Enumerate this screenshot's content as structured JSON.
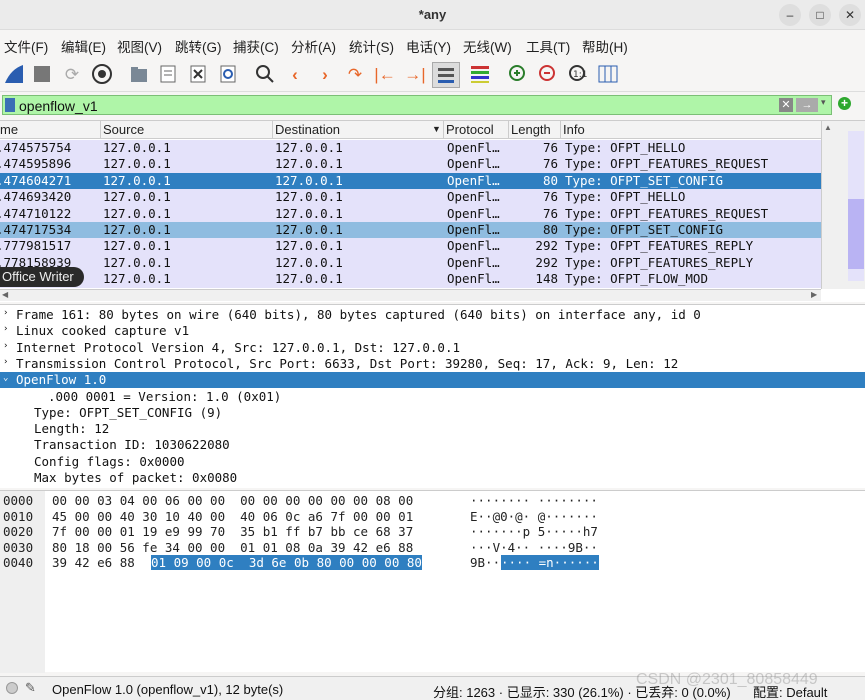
{
  "window": {
    "title": "*any"
  },
  "menu": [
    "文件(F)",
    "编辑(E)",
    "视图(V)",
    "跳转(G)",
    "捕获(C)",
    "分析(A)",
    "统计(S)",
    "电话(Y)",
    "无线(W)",
    "工具(T)",
    "帮助(H)"
  ],
  "filter": {
    "value": "openflow_v1"
  },
  "columns": [
    "me",
    "Source",
    "Destination",
    "Protocol",
    "Length",
    "Info"
  ],
  "packets": [
    {
      "time": ".474575754",
      "src": "127.0.0.1",
      "dst": "127.0.0.1",
      "proto": "OpenFl…",
      "len": "76",
      "info": "Type: OFPT_HELLO",
      "state": "normal"
    },
    {
      "time": ".474595896",
      "src": "127.0.0.1",
      "dst": "127.0.0.1",
      "proto": "OpenFl…",
      "len": "76",
      "info": "Type: OFPT_FEATURES_REQUEST",
      "state": "normal"
    },
    {
      "time": ".474604271",
      "src": "127.0.0.1",
      "dst": "127.0.0.1",
      "proto": "OpenFl…",
      "len": "80",
      "info": "Type: OFPT_SET_CONFIG",
      "state": "selected"
    },
    {
      "time": ".474693420",
      "src": "127.0.0.1",
      "dst": "127.0.0.1",
      "proto": "OpenFl…",
      "len": "76",
      "info": "Type: OFPT_HELLO",
      "state": "normal"
    },
    {
      "time": ".474710122",
      "src": "127.0.0.1",
      "dst": "127.0.0.1",
      "proto": "OpenFl…",
      "len": "76",
      "info": "Type: OFPT_FEATURES_REQUEST",
      "state": "normal"
    },
    {
      "time": ".474717534",
      "src": "127.0.0.1",
      "dst": "127.0.0.1",
      "proto": "OpenFl…",
      "len": "80",
      "info": "Type: OFPT_SET_CONFIG",
      "state": "related"
    },
    {
      "time": ".777981517",
      "src": "127.0.0.1",
      "dst": "127.0.0.1",
      "proto": "OpenFl…",
      "len": "292",
      "info": "Type: OFPT_FEATURES_REPLY",
      "state": "normal"
    },
    {
      "time": ".778158939",
      "src": "127.0.0.1",
      "dst": "127.0.0.1",
      "proto": "OpenFl…",
      "len": "292",
      "info": "Type: OFPT_FEATURES_REPLY",
      "state": "normal"
    },
    {
      "time": ".",
      "src": "127.0.0.1",
      "dst": "127.0.0.1",
      "proto": "OpenFl…",
      "len": "148",
      "info": "Type: OFPT_FLOW_MOD",
      "state": "normal"
    }
  ],
  "tooltip": "Office Writer",
  "details": [
    {
      "indent": 0,
      "tri": "›",
      "text": "Frame 161: 80 bytes on wire (640 bits), 80 bytes captured (640 bits) on interface any, id 0",
      "sel": false
    },
    {
      "indent": 0,
      "tri": "›",
      "text": "Linux cooked capture v1",
      "sel": false
    },
    {
      "indent": 0,
      "tri": "›",
      "text": "Internet Protocol Version 4, Src: 127.0.0.1, Dst: 127.0.0.1",
      "sel": false
    },
    {
      "indent": 0,
      "tri": "›",
      "text": "Transmission Control Protocol, Src Port: 6633, Dst Port: 39280, Seq: 17, Ack: 9, Len: 12",
      "sel": false
    },
    {
      "indent": 0,
      "tri": "⌄",
      "text": "OpenFlow 1.0",
      "sel": true
    },
    {
      "indent": 2,
      "tri": "",
      "text": ".000 0001 = Version: 1.0 (0x01)",
      "sel": false
    },
    {
      "indent": 1,
      "tri": "",
      "text": "Type: OFPT_SET_CONFIG (9)",
      "sel": false
    },
    {
      "indent": 1,
      "tri": "",
      "text": "Length: 12",
      "sel": false
    },
    {
      "indent": 1,
      "tri": "",
      "text": "Transaction ID: 1030622080",
      "sel": false
    },
    {
      "indent": 1,
      "tri": "",
      "text": "Config flags: 0x0000",
      "sel": false
    },
    {
      "indent": 1,
      "tri": "",
      "text": "Max bytes of packet: 0x0080",
      "sel": false
    }
  ],
  "bytes": [
    {
      "off": "0000",
      "hex": "00 00 03 04 00 06 00 00  00 00 00 00 00 00 08 00",
      "ascii": "········ ········",
      "selHex": "",
      "selAscii": ""
    },
    {
      "off": "0010",
      "hex": "45 00 00 40 30 10 40 00  40 06 0c a6 7f 00 00 01",
      "ascii": "E··@0·@· @·······",
      "selHex": "",
      "selAscii": ""
    },
    {
      "off": "0020",
      "hex": "7f 00 00 01 19 e9 99 70  35 b1 ff b7 bb ce 68 37",
      "ascii": "·······p 5·····h7",
      "selHex": "",
      "selAscii": ""
    },
    {
      "off": "0030",
      "hex": "80 18 00 56 fe 34 00 00  01 01 08 0a 39 42 e6 88",
      "ascii": "···V·4·· ····9B··",
      "selHex": "",
      "selAscii": ""
    },
    {
      "off": "0040",
      "hex": "39 42 e6 88 ",
      "ascii": "9B··",
      "selHex": "01 09 00 0c  3d 6e 0b 80 00 00 00 80",
      "selAscii": "···· =n······"
    }
  ],
  "status": {
    "left": "OpenFlow 1.0 (openflow_v1), 12 byte(s)",
    "right": "分组: 1263 · 已显示: 330 (26.1%) · 已丢弃: 0 (0.0%)",
    "profile": "配置: Default"
  },
  "watermark": "CSDN @2301_80858449",
  "colors": {
    "selected": "#2f7fc1",
    "related": "#8fbce0",
    "openflow_row": "#e4e2fa",
    "filter_ok": "#aff5a8"
  }
}
